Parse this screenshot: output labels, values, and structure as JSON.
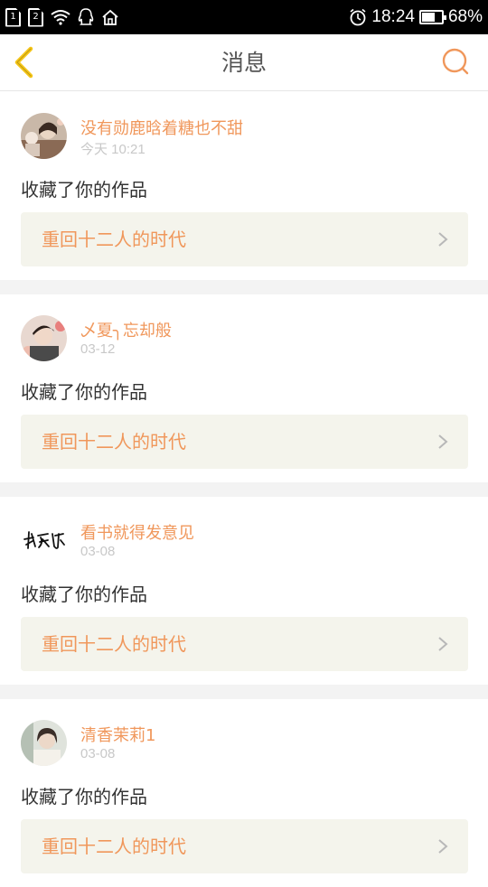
{
  "status_bar": {
    "sim1": "1",
    "sim2": "2",
    "time": "18:24",
    "battery": "68%",
    "battery_level": 0.68,
    "icons": [
      "sim1-icon",
      "sim2-icon",
      "wifi-icon",
      "qq-icon",
      "home-icon",
      "alarm-icon",
      "battery-icon"
    ]
  },
  "nav": {
    "title": "消息",
    "back_icon": "chevron-left-icon",
    "search_icon": "search-icon",
    "accent": "#f5c518",
    "search_color": "#f0975b"
  },
  "colors": {
    "accent_orange": "#f0975b",
    "card_link_bg": "#f4f4ec",
    "separator": "#f3f3f3"
  },
  "messages": [
    {
      "username": "没有勋鹿晗着糖也不甜",
      "time": "今天 10:21",
      "action": "收藏了你的作品",
      "work": "重回十二人的时代",
      "avatar": "avatar-photo-icon"
    },
    {
      "username": "乄夏╮忘却般",
      "time": "03-12",
      "action": "收藏了你的作品",
      "work": "重回十二人的时代",
      "avatar": "avatar-photo-icon"
    },
    {
      "username": "看书就得发意见",
      "time": "03-08",
      "action": "收藏了你的作品",
      "work": "重回十二人的时代",
      "avatar": "avatar-calligraphy-icon"
    },
    {
      "username": "清香茉莉1",
      "time": "03-08",
      "action": "收藏了你的作品",
      "work": "重回十二人的时代",
      "avatar": "avatar-photo-icon"
    }
  ]
}
